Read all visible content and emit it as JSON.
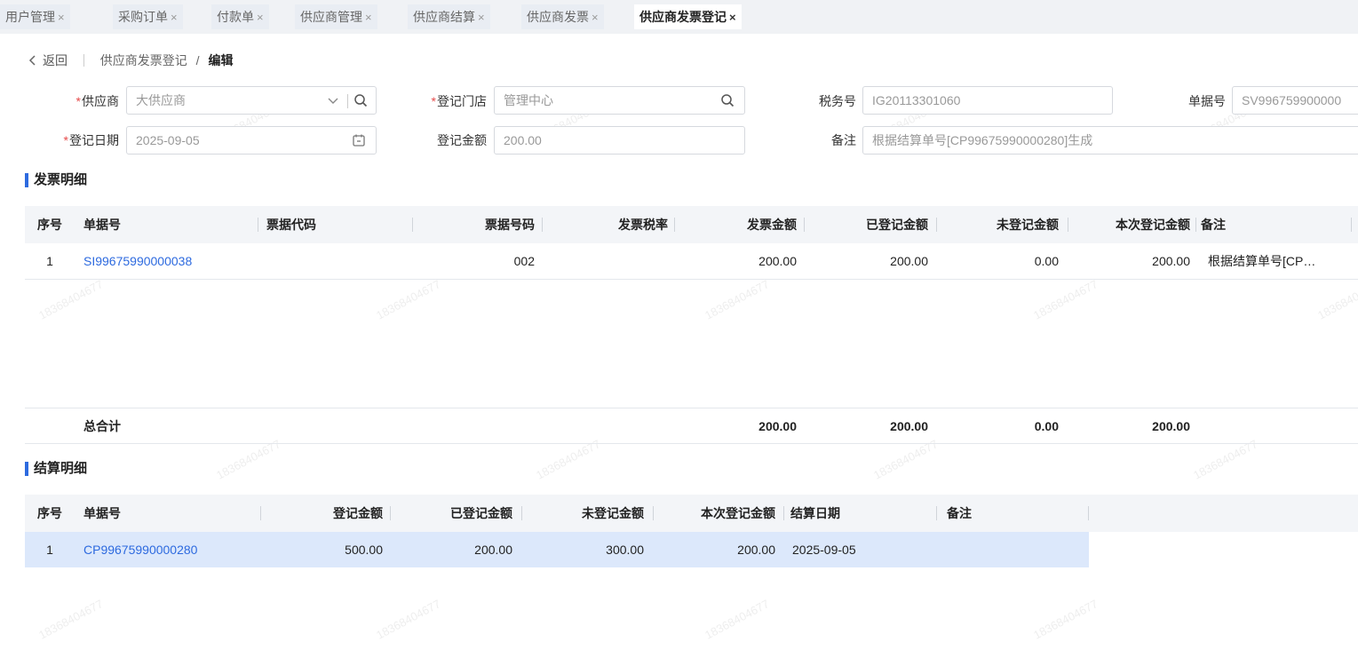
{
  "tabs": [
    {
      "label": "用户管理",
      "close": "×"
    },
    {
      "label": "采购订单",
      "close": "×"
    },
    {
      "label": "付款单",
      "close": "×"
    },
    {
      "label": "供应商管理",
      "close": "×"
    },
    {
      "label": "供应商结算",
      "close": "×"
    },
    {
      "label": "供应商发票",
      "close": "×"
    },
    {
      "label": "供应商发票登记",
      "close": "×"
    }
  ],
  "breadcrumb": {
    "back": "返回",
    "parent": "供应商发票登记",
    "divider": "/",
    "current": "编辑"
  },
  "form": {
    "required_mark": "*",
    "supplier": {
      "label": "供应商",
      "value": "大供应商"
    },
    "store": {
      "label": "登记门店",
      "value": "管理中心"
    },
    "tax_no": {
      "label": "税务号",
      "value": "IG20113301060"
    },
    "doc_no": {
      "label": "单据号",
      "value": "SV996759900000"
    },
    "reg_date": {
      "label": "登记日期",
      "value": "2025-09-05"
    },
    "reg_amount": {
      "label": "登记金额",
      "value": "200.00"
    },
    "remark": {
      "label": "备注",
      "value": "根据结算单号[CP99675990000280]生成"
    }
  },
  "invoice_section": {
    "title": "发票明细",
    "columns": [
      "序号",
      "单据号",
      "票据代码",
      "票据号码",
      "发票税率",
      "发票金额",
      "已登记金额",
      "未登记金额",
      "本次登记金额",
      "备注"
    ],
    "rows": [
      {
        "seq": "1",
        "doc_no": "SI99675990000038",
        "code": "",
        "number": "002",
        "tax_rate": "",
        "amount": "200.00",
        "registered": "200.00",
        "unregistered": "0.00",
        "this_time": "200.00",
        "remark": "根据结算单号[CP…"
      }
    ],
    "total": {
      "label": "总合计",
      "amount": "200.00",
      "registered": "200.00",
      "unregistered": "0.00",
      "this_time": "200.00"
    }
  },
  "settle_section": {
    "title": "结算明细",
    "columns": [
      "序号",
      "单据号",
      "登记金额",
      "已登记金额",
      "未登记金额",
      "本次登记金额",
      "结算日期",
      "备注"
    ],
    "rows": [
      {
        "seq": "1",
        "doc_no": "CP99675990000280",
        "reg_amount": "500.00",
        "registered": "200.00",
        "unregistered": "300.00",
        "this_time": "200.00",
        "date": "2025-09-05",
        "remark": ""
      }
    ]
  },
  "watermark": "18368404677"
}
